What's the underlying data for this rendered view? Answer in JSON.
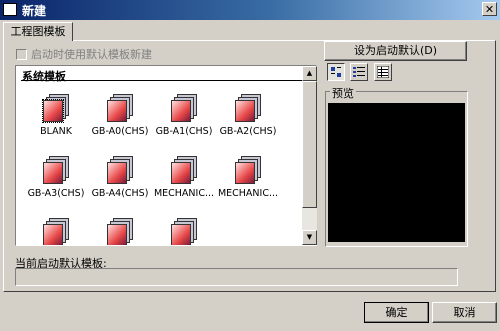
{
  "window": {
    "title": "新建",
    "close_glyph": "✕"
  },
  "tabs": [
    {
      "label": "工程图模板",
      "active": true
    }
  ],
  "options": {
    "use_default_on_startup_label": "启动时使用默认模板新建",
    "use_default_on_startup_checked": false,
    "enabled": false
  },
  "buttons": {
    "set_default": "设为启动默认(D)",
    "ok": "确定",
    "cancel": "取消"
  },
  "template_list": {
    "group_title": "系统模板",
    "items": [
      {
        "label": "BLANK",
        "selected": true
      },
      {
        "label": "GB-A0(CHS)"
      },
      {
        "label": "GB-A1(CHS)"
      },
      {
        "label": "GB-A2(CHS)"
      },
      {
        "label": "GB-A3(CHS)"
      },
      {
        "label": "GB-A4(CHS)"
      },
      {
        "label": "MECHANIC..."
      },
      {
        "label": "MECHANIC..."
      },
      {
        "label": ""
      },
      {
        "label": ""
      },
      {
        "label": ""
      }
    ]
  },
  "view_modes": [
    {
      "name": "large-icons",
      "active": true
    },
    {
      "name": "list"
    },
    {
      "name": "details"
    }
  ],
  "preview": {
    "label": "预览",
    "background": "#000000"
  },
  "current_default": {
    "label": "当前启动默认模板:",
    "value": ""
  },
  "colors": {
    "title_gradient_start": "#0a246a",
    "title_gradient_end": "#a6caf0",
    "face": "#d4d0c8"
  }
}
